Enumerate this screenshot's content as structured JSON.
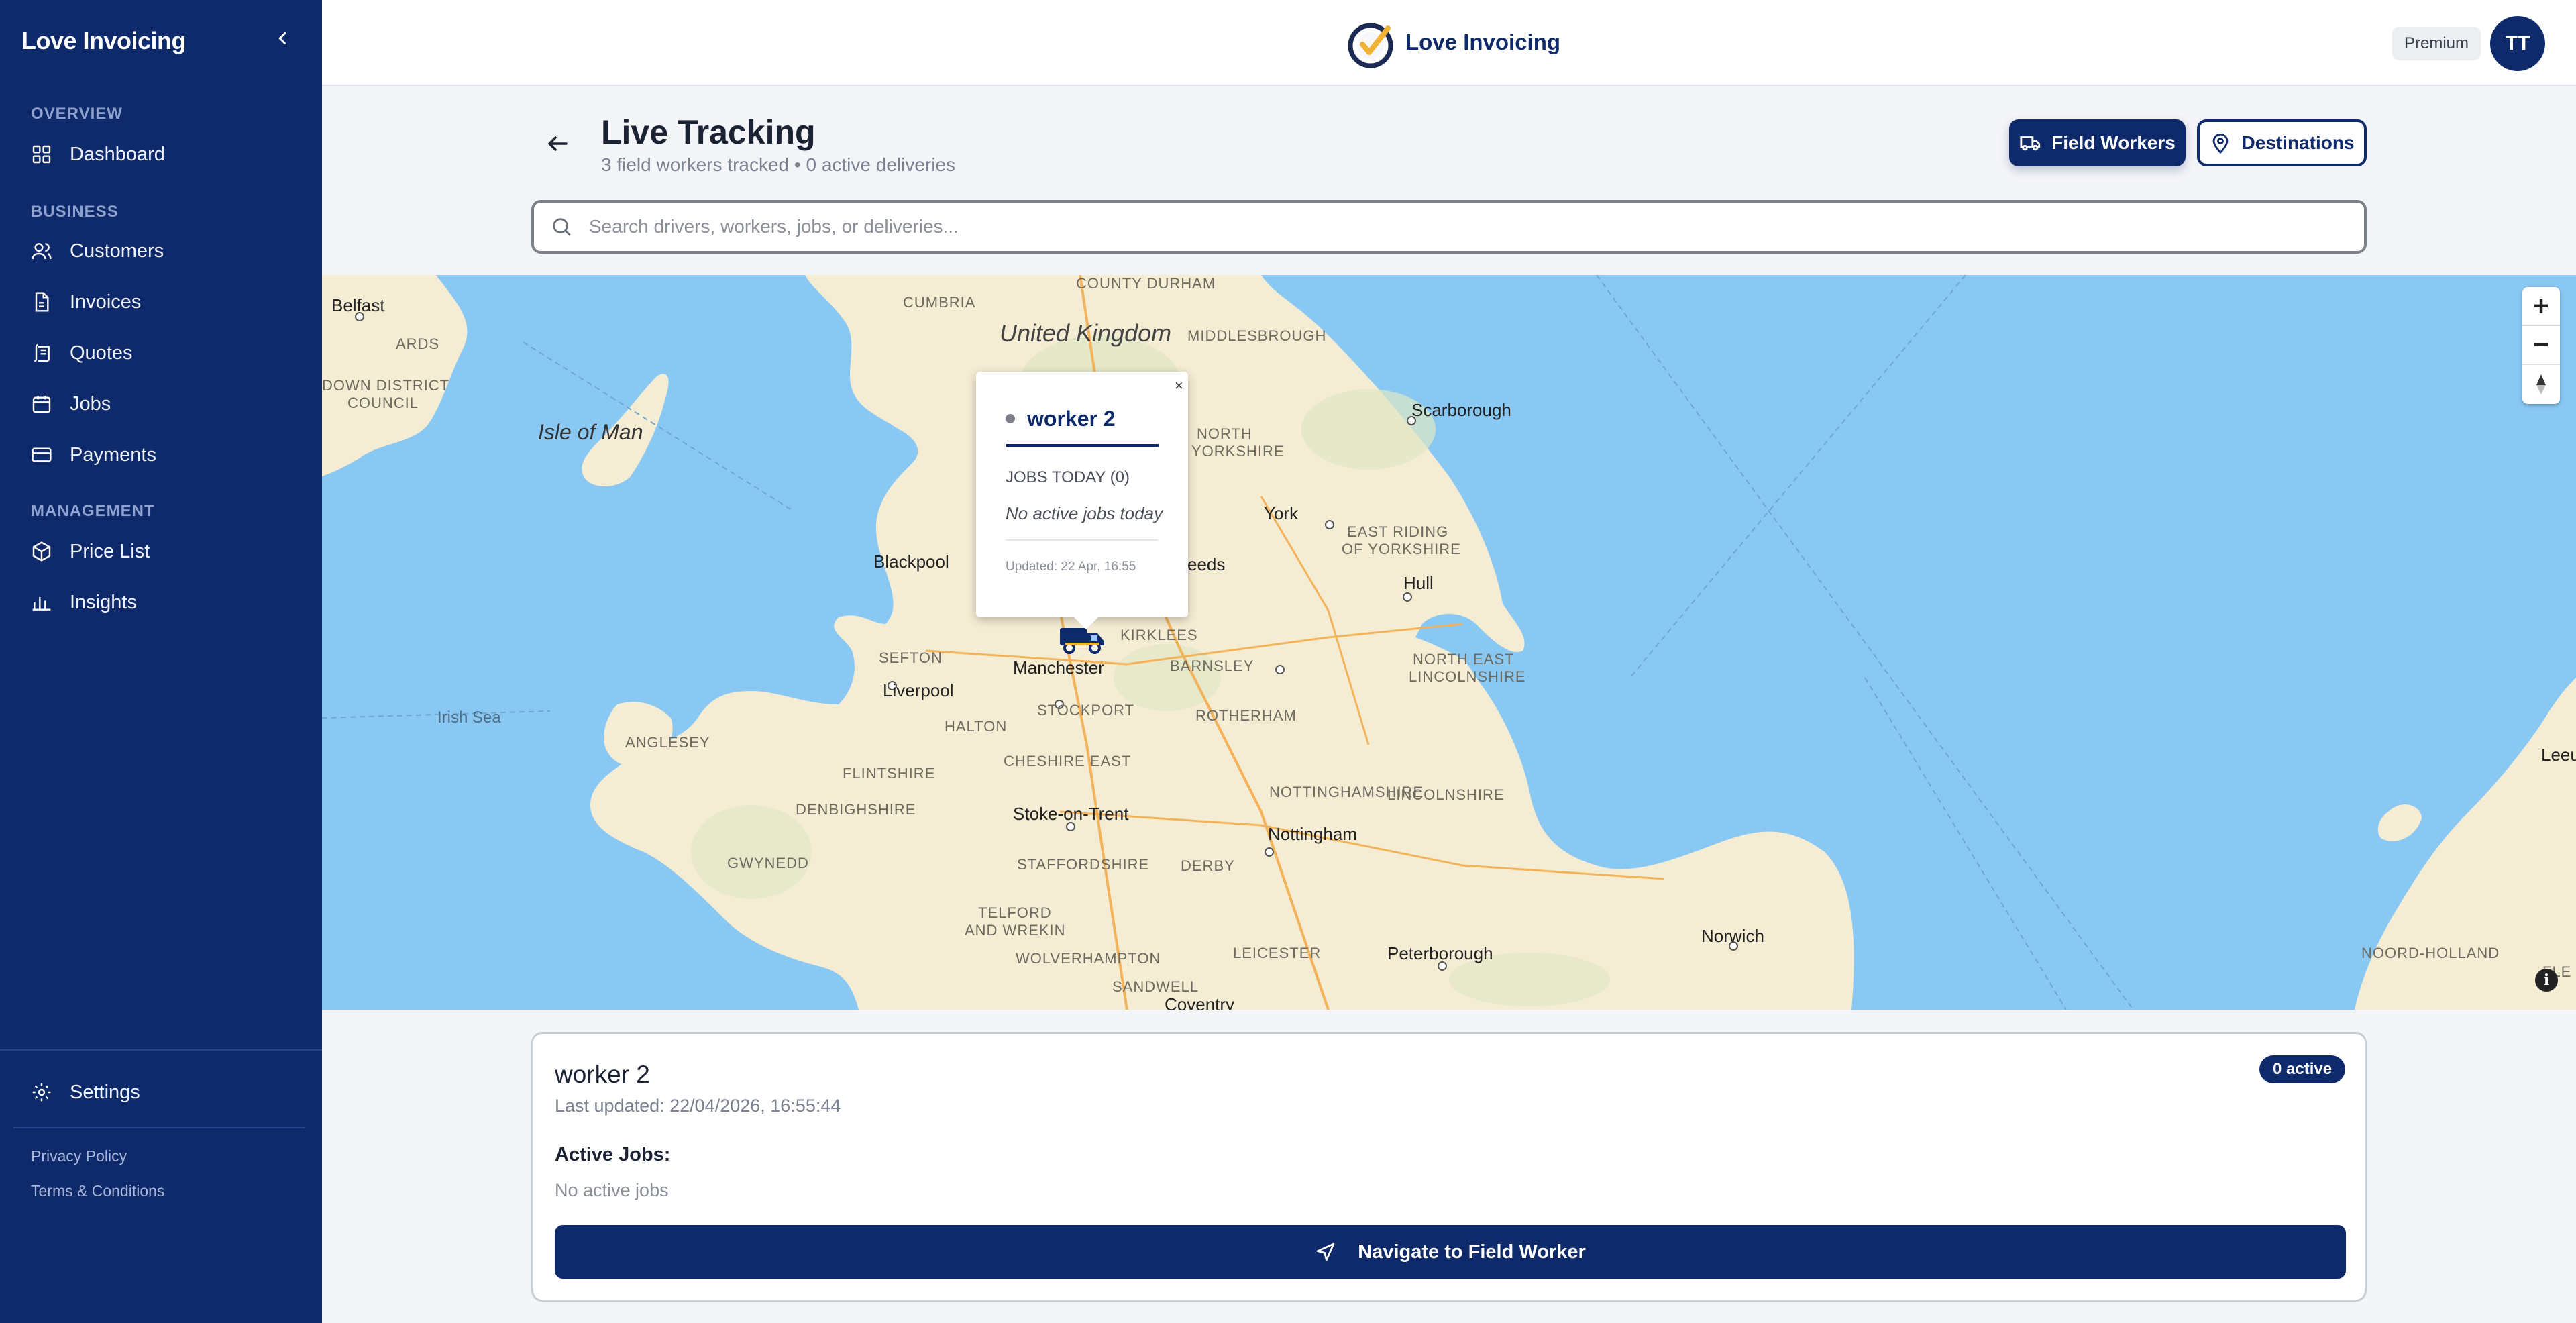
{
  "sidebar": {
    "brand": "Love Invoicing",
    "sections": {
      "overview": "OVERVIEW",
      "business": "BUSINESS",
      "management": "MANAGEMENT"
    },
    "items": {
      "dashboard": "Dashboard",
      "customers": "Customers",
      "invoices": "Invoices",
      "quotes": "Quotes",
      "jobs": "Jobs",
      "payments": "Payments",
      "price_list": "Price List",
      "insights": "Insights",
      "settings": "Settings"
    },
    "footer": {
      "privacy": "Privacy Policy",
      "terms": "Terms & Conditions"
    }
  },
  "topbar": {
    "title": "Love Invoicing",
    "plan": "Premium",
    "avatar_initials": "TT"
  },
  "header": {
    "title": "Live Tracking",
    "subtitle": "3 field workers tracked • 0 active deliveries",
    "field_workers_label": "Field Workers",
    "destinations_label": "Destinations"
  },
  "search": {
    "placeholder": "Search drivers, workers, jobs, or deliveries..."
  },
  "map": {
    "labels": {
      "belfast": "Belfast",
      "cumbria": "CUMBRIA",
      "county_durham": "COUNTY DURHAM",
      "united_kingdom": "United Kingdom",
      "middlesbrough": "MIDDLESBROUGH",
      "ards": "ARDS",
      "down_district": "DOWN DISTRICT",
      "council": "COUNCIL",
      "isle_of_man": "Isle of Man",
      "north_yorkshire_1": "NORTH",
      "north_yorkshire_2": "YORKSHIRE",
      "scarborough": "Scarborough",
      "york": "York",
      "east_riding_1": "EAST RIDING",
      "east_riding_2": "OF YORKSHIRE",
      "blackpool": "Blackpool",
      "leeds": "eeds",
      "hull": "Hull",
      "kirklees": "KIRKLEES",
      "sefton": "SEFTON",
      "manchester": "Manchester",
      "barnsley": "BARNSLEY",
      "north_east_1": "NORTH EAST",
      "north_east_2": "LINCOLNSHIRE",
      "liverpool": "Liverpool",
      "irish_sea": "Irish Sea",
      "halton": "HALTON",
      "stockport": "STOCKPORT",
      "rotherham": "ROTHERHAM",
      "anglesey": "ANGLESEY",
      "flintshire": "FLINTSHIRE",
      "cheshire_east": "CHESHIRE EAST",
      "nottinghamshire": "NOTTINGHAMSHIRE",
      "lincolnshire": "LINCOLNSHIRE",
      "denbighshire": "DENBIGHSHIRE",
      "stoke": "Stoke-on-Trent",
      "nottingham": "Nottingham",
      "gwynedd": "GWYNEDD",
      "staffordshire": "STAFFORDSHIRE",
      "derby": "DERBY",
      "telford_1": "TELFORD",
      "telford_2": "AND WREKIN",
      "leicester": "LEICESTER",
      "peterborough": "Peterborough",
      "norwich": "Norwich",
      "wolverhampton": "WOLVERHAMPTON",
      "sandwell": "SANDWELL",
      "coventry": "Coventry",
      "noord_holland": "NOORD-HOLLAND",
      "leeu": "Leeu",
      "fle": "FLE"
    },
    "zoom_in": "+",
    "zoom_out": "−",
    "info": "i"
  },
  "popup": {
    "close": "×",
    "worker_name": "worker 2",
    "jobs_today": "JOBS TODAY (0)",
    "no_jobs": "No active jobs today",
    "updated": "Updated: 22 Apr, 16:55"
  },
  "card": {
    "worker_name": "worker 2",
    "last_updated": "Last updated: 22/04/2026, 16:55:44",
    "active_badge": "0 active",
    "active_jobs_label": "Active Jobs:",
    "no_active_jobs": "No active jobs",
    "navigate_label": "Navigate to Field Worker"
  },
  "colors": {
    "brand": "#0e2a6b",
    "sea": "#8ac8f4",
    "land": "#f5ecd4"
  }
}
